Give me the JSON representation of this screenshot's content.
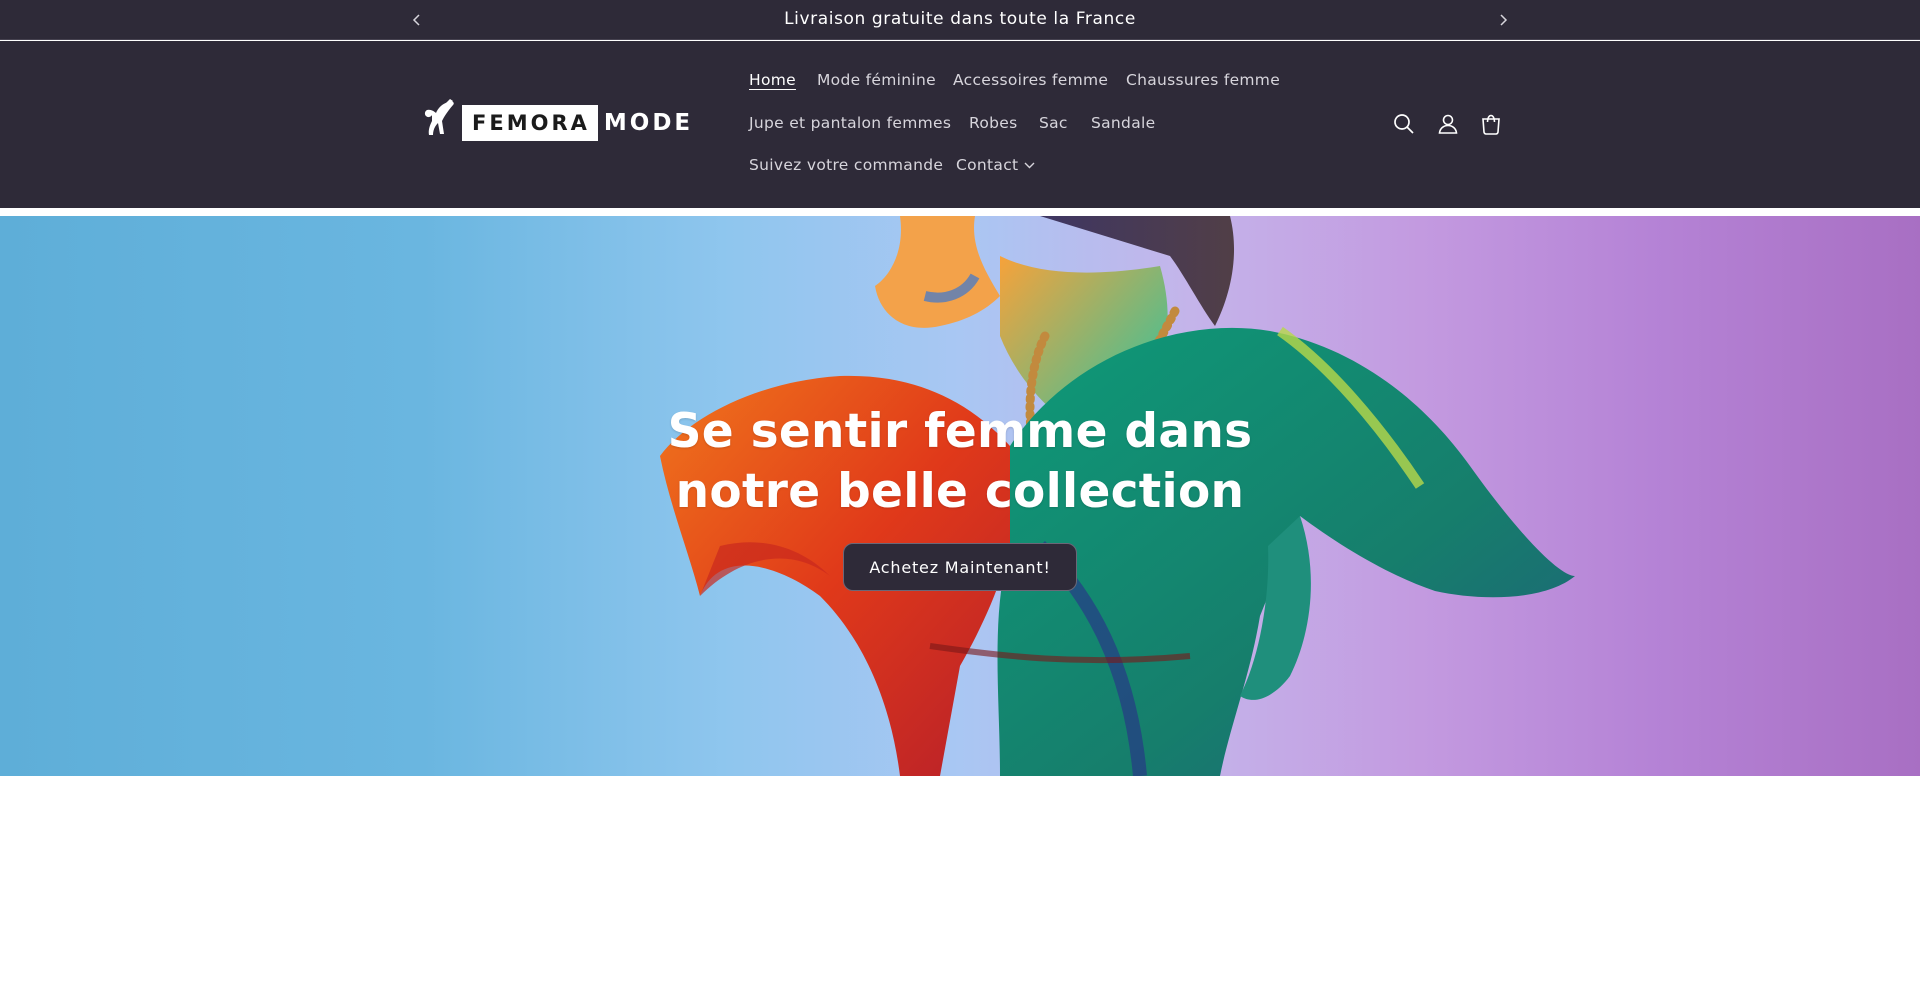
{
  "announcement": {
    "text": "Livraison gratuite dans toute la France",
    "prev_icon": "chevron-left-icon",
    "next_icon": "chevron-right-icon"
  },
  "logo": {
    "word_boxed": "FEMORA",
    "word_plain": "MODE"
  },
  "nav": {
    "items": [
      {
        "label": "Home",
        "active": true
      },
      {
        "label": "Mode féminine"
      },
      {
        "label": "Accessoires femme"
      },
      {
        "label": "Chaussures femme"
      },
      {
        "label": "Jupe et pantalon femmes"
      },
      {
        "label": "Robes"
      },
      {
        "label": "Sac"
      },
      {
        "label": "Sandale"
      },
      {
        "label": "Suivez votre commande"
      },
      {
        "label": "Contact",
        "has_dropdown": true
      }
    ]
  },
  "header_icons": {
    "search": "search-icon",
    "account": "account-icon",
    "cart": "cart-icon"
  },
  "hero": {
    "headline_line1": "Se sentir femme dans",
    "headline_line2": "notre belle collection",
    "cta_label": "Achetez Maintenant!"
  },
  "colors": {
    "header_bg": "#2e2a38",
    "button_bg": "#2e2a38",
    "text_light": "#ffffff"
  }
}
